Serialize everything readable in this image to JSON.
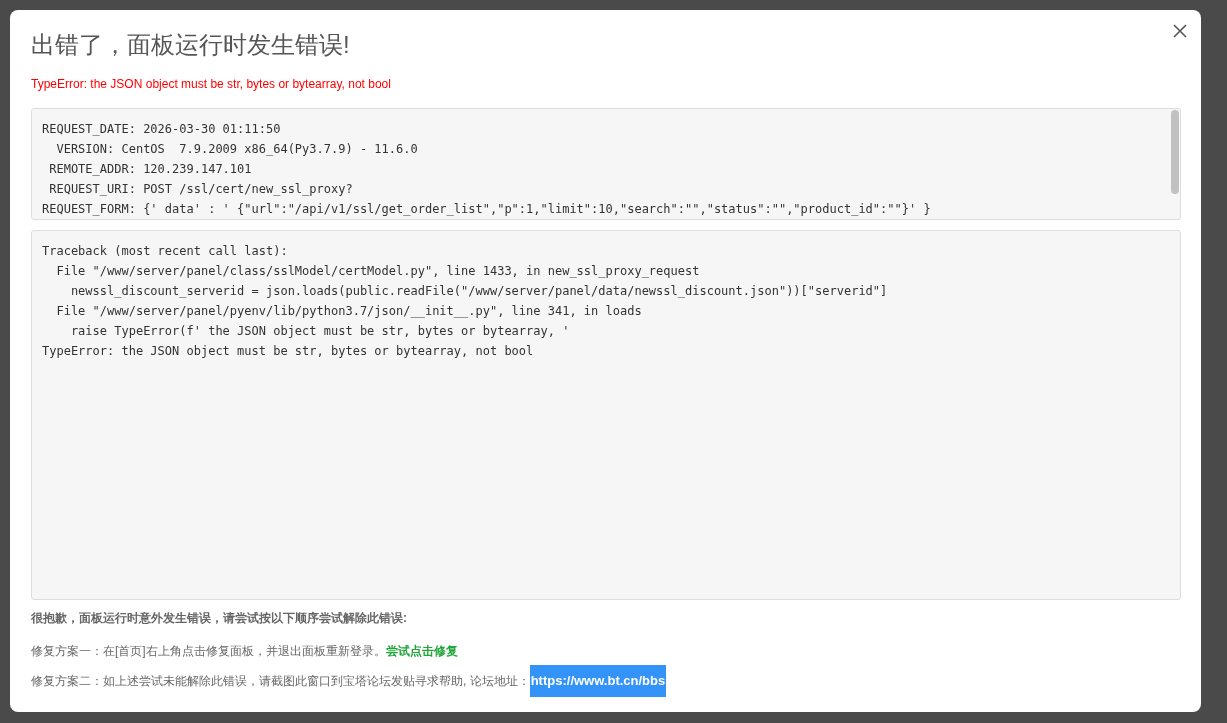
{
  "dialog": {
    "title": "出错了，面板运行时发生错误!",
    "error_message": "TypeError: the JSON object must be str, bytes or bytearray, not bool",
    "request_info": [
      "REQUEST_DATE: 2026-03-30 01:11:50",
      "  VERSION: CentOS  7.9.2009 x86_64(Py3.7.9) - 11.6.0",
      " REMOTE_ADDR: 120.239.147.101",
      " REQUEST_URI: POST /ssl/cert/new_ssl_proxy?",
      "REQUEST_FORM: {' data' : ' {\"url\":\"/api/v1/ssl/get_order_list\",\"p\":1,\"limit\":10,\"search\":\"\",\"status\":\"\",\"product_id\":\"\"}' }"
    ],
    "traceback": [
      "Traceback (most recent call last):",
      "  File \"/www/server/panel/class/sslModel/certModel.py\", line 1433, in new_ssl_proxy_request",
      "    newssl_discount_serverid = json.loads(public.readFile(\"/www/server/panel/data/newssl_discount.json\"))[\"serverid\"]",
      "  File \"/www/server/panel/pyenv/lib/python3.7/json/__init__.py\", line 341, in loads",
      "    raise TypeError(f' the JSON object must be str, bytes or bytearray, '",
      "TypeError: the JSON object must be str, bytes or bytearray, not bool"
    ],
    "apology": "很抱歉，面板运行时意外发生错误，请尝试按以下顺序尝试解除此错误:",
    "solutions": [
      {
        "text": "修复方案一：在[首页]右上角点击修复面板，并退出面板重新登录。",
        "link": "尝试点击修复",
        "kind": "action"
      },
      {
        "text": "修复方案二：如上述尝试未能解除此错误，请截图此窗口到宝塔论坛发贴寻求帮助, 论坛地址：",
        "link": "https://www.bt.cn/bbs",
        "kind": "url"
      }
    ]
  }
}
